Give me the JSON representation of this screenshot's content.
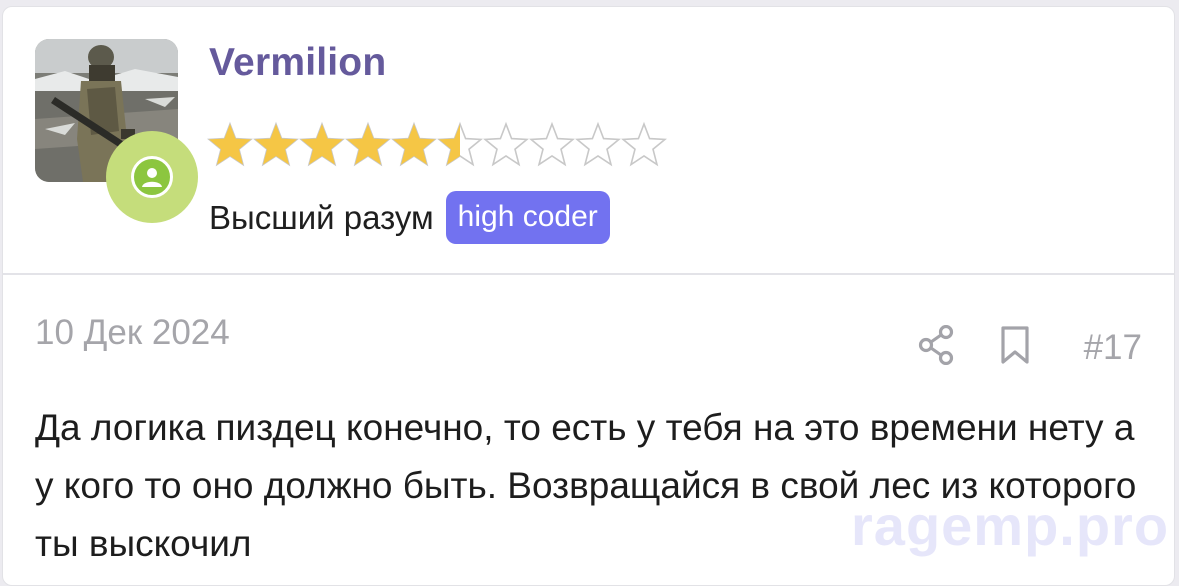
{
  "user": {
    "name": "Vermilion",
    "rank_title": "Высший разум",
    "badge": "high coder",
    "rating": {
      "value": 5.5,
      "max": 10
    },
    "online": true
  },
  "post": {
    "date": "10 Дек 2024",
    "number": "#17",
    "message": "Да логика пиздец конечно, то есть у тебя на это времени нету а у кого то оно должно быть. Возвращайся в свой лес из которого ты выскочил"
  },
  "watermark": "ragemp.pro",
  "colors": {
    "username": "#655a9c",
    "badge_bg": "#7272f0",
    "star_fill": "#f5c645",
    "online_outer": "#c5dd7b",
    "online_inner": "#8cc63f"
  },
  "icons": {
    "share": "share-icon",
    "bookmark": "bookmark-icon",
    "online": "user-icon"
  }
}
